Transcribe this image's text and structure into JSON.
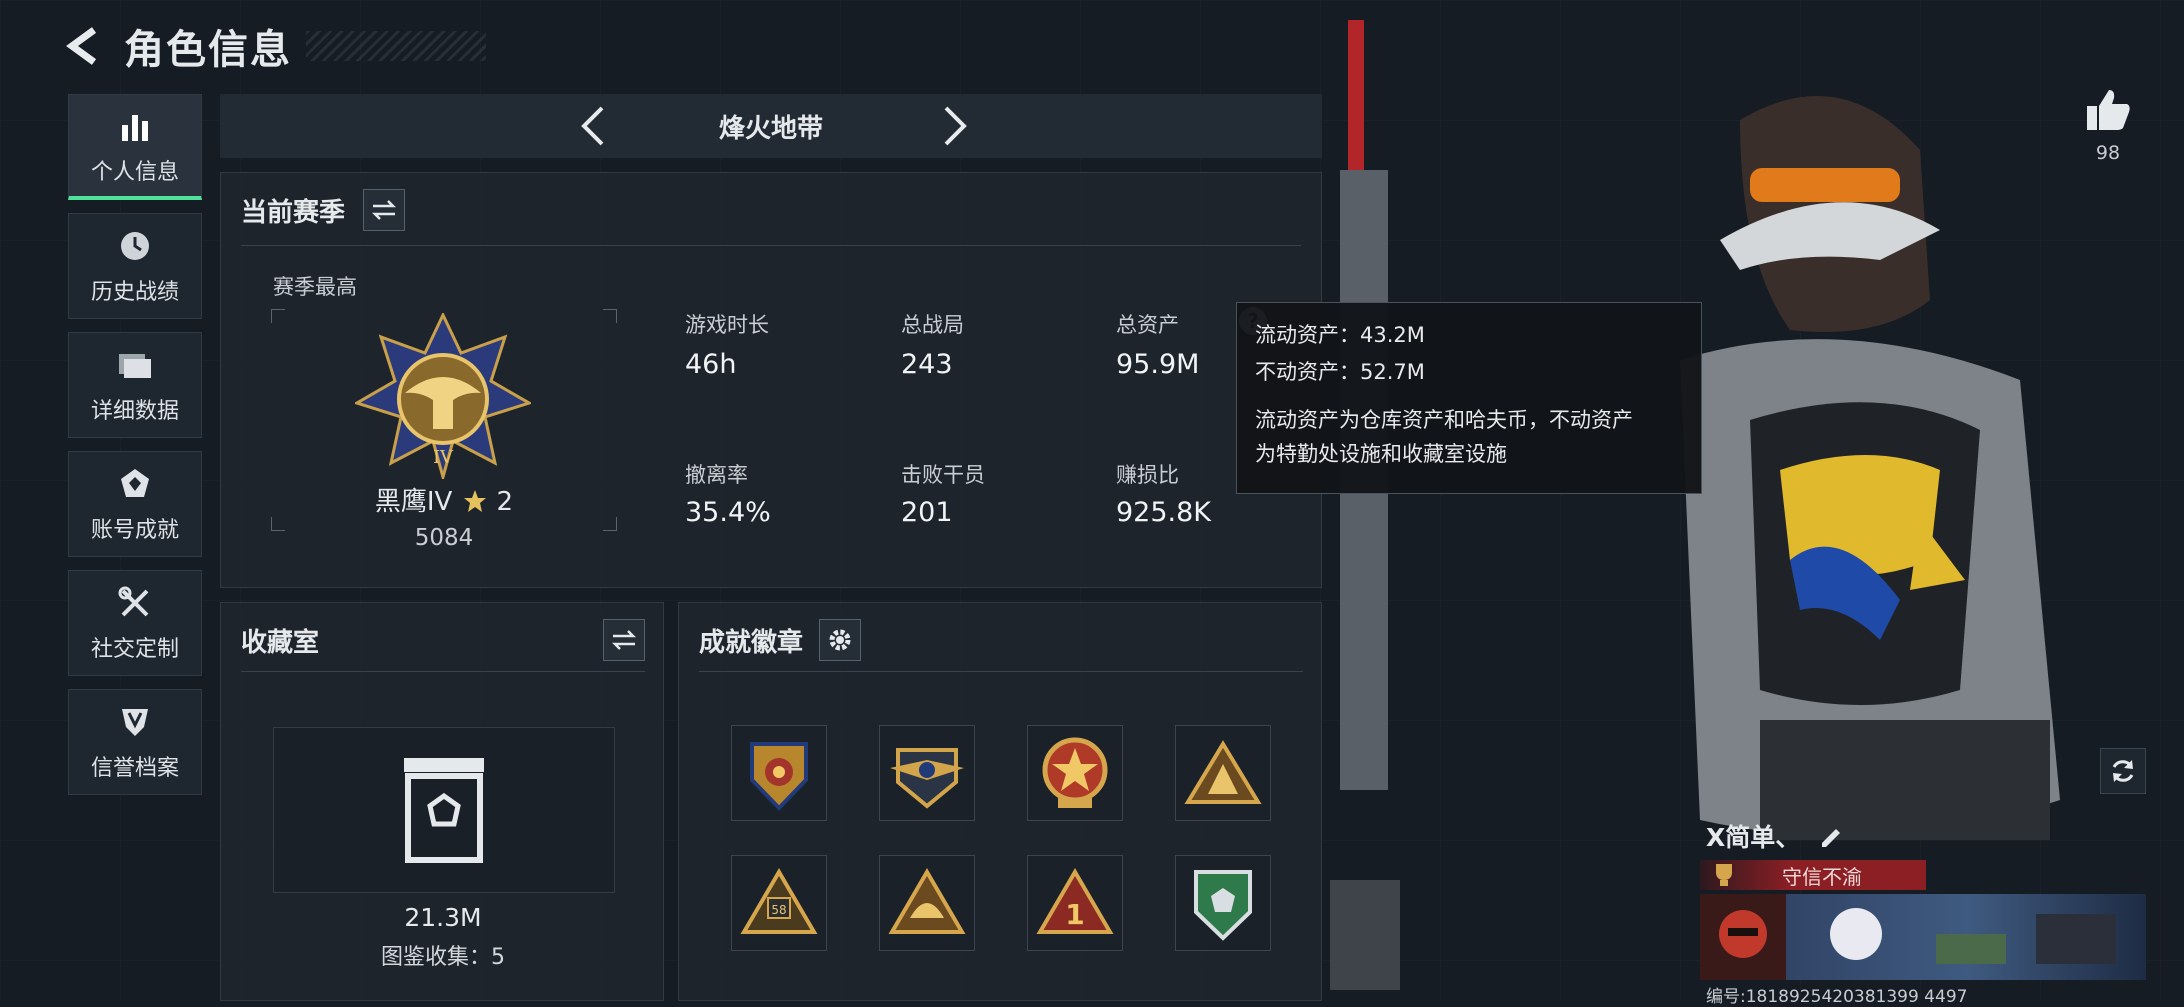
{
  "header": {
    "title": "角色信息"
  },
  "sidebar": {
    "items": [
      {
        "label": "个人信息",
        "icon": "bar-chart-icon",
        "active": true
      },
      {
        "label": "历史战绩",
        "icon": "clock-icon"
      },
      {
        "label": "详细数据",
        "icon": "folder-icon"
      },
      {
        "label": "账号成就",
        "icon": "achievement-icon"
      },
      {
        "label": "社交定制",
        "icon": "tools-icon"
      },
      {
        "label": "信誉档案",
        "icon": "shield-icon"
      }
    ]
  },
  "mode": {
    "label": "烽火地带"
  },
  "season": {
    "title": "当前赛季",
    "best_label": "赛季最高",
    "rank_name": "黑鹰IV",
    "rank_stars": "2",
    "rank_score": "5084",
    "stats": [
      {
        "label": "游戏时长",
        "value": "46h"
      },
      {
        "label": "总战局",
        "value": "243"
      },
      {
        "label": "总资产",
        "value": "95.9M"
      },
      {
        "label": "撤离率",
        "value": "35.4%"
      },
      {
        "label": "击败干员",
        "value": "201"
      },
      {
        "label": "赚损比",
        "value": "925.8K"
      }
    ]
  },
  "tooltip": {
    "liquid": "流动资产：43.2M",
    "fixed": "不动资产：52.7M",
    "desc1": "流动资产为仓库资产和哈夫币，不动资产",
    "desc2": "为特勤处设施和收藏室设施"
  },
  "collection": {
    "title": "收藏室",
    "value": "21.3M",
    "collect_label": "图鉴收集：5"
  },
  "achievements": {
    "title": "成就徽章",
    "badges": [
      "eagle-crest-badge",
      "wings-badge",
      "star-medal-badge",
      "tri-gold-badge",
      "sniper-badge",
      "helmet-badge",
      "number-one-badge",
      "green-shield-badge"
    ]
  },
  "right": {
    "likes": "98",
    "player_name": "X简单、",
    "player_title": "守信不渝",
    "id_text": "编号:1818925420381399 4497"
  },
  "colors": {
    "accent": "#4fe09a",
    "red_title": "#8b1f24",
    "background": "#151c24"
  }
}
